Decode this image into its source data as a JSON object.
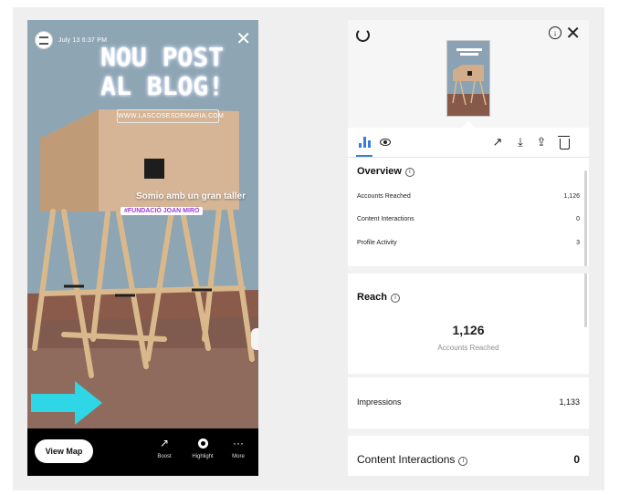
{
  "story": {
    "date": "July 13  6:37 PM",
    "headline_line1": "NOU POST",
    "headline_line2": "AL BLOG!",
    "link_sticker": "WWW.LASCOSESDEMARIA.COM",
    "caption": "Somio amb un gran taller",
    "mention": "#FUNDACIÓ JOAN MIRÓ",
    "view_map": "View Map",
    "actions": [
      {
        "label": "Boost",
        "icon": "trend-up-icon"
      },
      {
        "label": "Highlight",
        "icon": "heart-icon"
      },
      {
        "label": "More",
        "icon": "more-icon"
      }
    ]
  },
  "insights": {
    "overview": {
      "title": "Overview",
      "rows": [
        {
          "label": "Accounts Reached",
          "value": "1,126"
        },
        {
          "label": "Content Interactions",
          "value": "0"
        },
        {
          "label": "Profile Activity",
          "value": "3"
        }
      ]
    },
    "reach": {
      "title": "Reach",
      "value": "1,126",
      "sublabel": "Accounts Reached"
    },
    "impressions": {
      "label": "Impressions",
      "value": "1,133"
    },
    "content_interactions": {
      "label": "Content Interactions",
      "value": "0"
    }
  },
  "colors": {
    "accent": "#3b7be0",
    "story_bg": "#8fa6b4",
    "arrow": "#2fd6e6",
    "mention": "#9b3dd8"
  }
}
